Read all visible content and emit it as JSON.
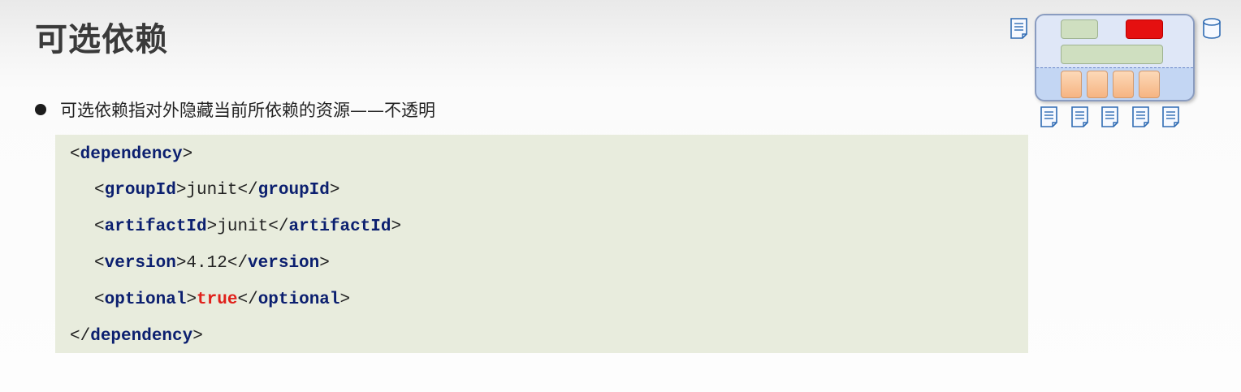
{
  "slide": {
    "title": "可选依赖",
    "bullet": "可选依赖指对外隐藏当前所依赖的资源——不透明"
  },
  "code": {
    "line1": {
      "open": "<",
      "tag": "dependency",
      "close": ">"
    },
    "line2": {
      "open": "<",
      "tag": "groupId",
      "mid": ">junit</",
      "tag2": "groupId",
      "close": ">"
    },
    "line3": {
      "open": "<",
      "tag": "artifactId",
      "mid": ">junit</",
      "tag2": "artifactId",
      "close": ">"
    },
    "line4": {
      "open": "<",
      "tag": "version",
      "mid": ">4.12</",
      "tag2": "version",
      "close": ">"
    },
    "line5": {
      "open": "<",
      "tag": "optional",
      "gt": ">",
      "value": "true",
      "mid": "</",
      "tag2": "optional",
      "close": ">"
    },
    "line6": {
      "open": "</",
      "tag": "dependency",
      "close": ">"
    }
  },
  "colors": {
    "tag": "#0b1f6f",
    "true_value": "#e0201a",
    "code_background": "#e8ecdd"
  },
  "diagram": {
    "icons": [
      "document-icon",
      "database-icon"
    ]
  }
}
